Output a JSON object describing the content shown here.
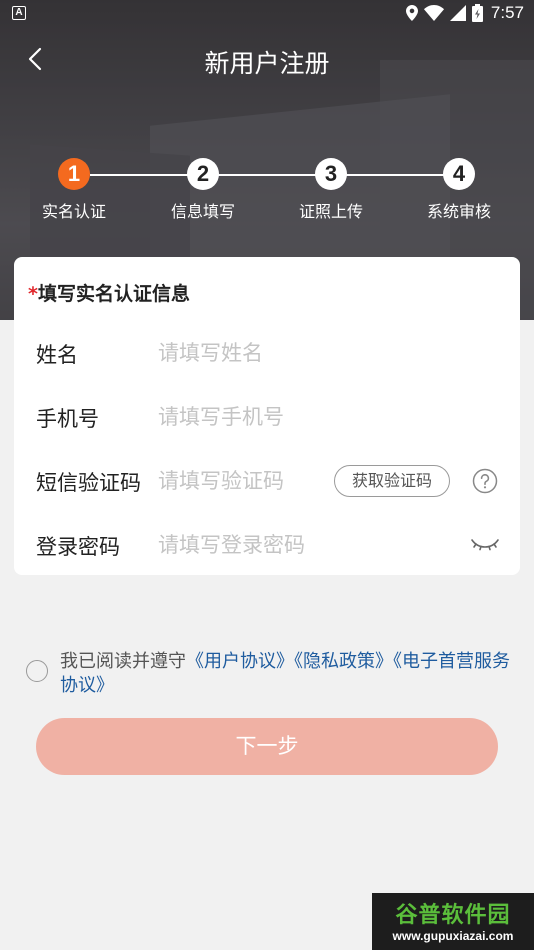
{
  "status_bar": {
    "badge": "A",
    "time": "7:57"
  },
  "nav": {
    "title": "新用户注册"
  },
  "steps": [
    {
      "number": "1",
      "label": "实名认证",
      "active": true
    },
    {
      "number": "2",
      "label": "信息填写",
      "active": false
    },
    {
      "number": "3",
      "label": "证照上传",
      "active": false
    },
    {
      "number": "4",
      "label": "系统审核",
      "active": false
    }
  ],
  "form": {
    "required_mark": "*",
    "title": "填写实名认证信息",
    "fields": {
      "name": {
        "label": "姓名",
        "placeholder": "请填写姓名",
        "value": ""
      },
      "phone": {
        "label": "手机号",
        "placeholder": "请填写手机号",
        "value": ""
      },
      "sms_code": {
        "label": "短信验证码",
        "placeholder": "请填写验证码",
        "value": ""
      },
      "password": {
        "label": "登录密码",
        "placeholder": "请填写登录密码",
        "value": ""
      }
    },
    "get_code_label": "获取验证码"
  },
  "agreement": {
    "prefix": "我已阅读并遵守",
    "links": [
      "《用户协议》",
      "《隐私政策》",
      "《电子首营服务协议》"
    ],
    "checked": false
  },
  "next_button": {
    "label": "下一步"
  },
  "watermark": {
    "title": "谷普软件园",
    "url": "www.gupuxiazai.com"
  },
  "colors": {
    "accent": "#f46a1f",
    "required": "#e0262b",
    "link": "#1f5c9f",
    "next_button": "#f0b1a4",
    "page_background": "#f1f1f1"
  }
}
